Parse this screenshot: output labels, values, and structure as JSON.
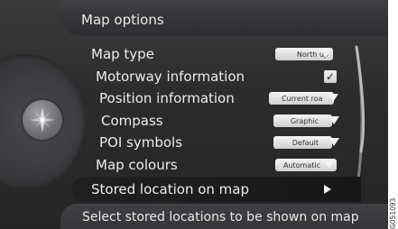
{
  "header": {
    "title": "Map options"
  },
  "menu": {
    "map_type": {
      "label": "Map type",
      "value": "North up"
    },
    "motorway_information": {
      "label": "Motorway information",
      "checked_symbol": "✓"
    },
    "position_information": {
      "label": "Position information",
      "value": "Current roa"
    },
    "compass": {
      "label": "Compass",
      "value": "Graphic"
    },
    "poi_symbols": {
      "label": "POI symbols",
      "value": "Default"
    },
    "map_colours": {
      "label": "Map colours",
      "value": "Automatic"
    },
    "stored_location": {
      "label": "Stored location on map"
    }
  },
  "footer": {
    "help_text": "Select stored locations to be shown on map"
  },
  "watermark": {
    "code": "G051093"
  },
  "icons": {
    "compass": "compass-icon",
    "dropdown": "chevron-down-icon",
    "submenu": "chevron-right-icon",
    "checkbox": "checkmark-icon"
  },
  "colors": {
    "background": "#2b2c2e",
    "text": "#ececec",
    "pill": "#e4e4e4",
    "selected_row": "#1a1b1d"
  }
}
